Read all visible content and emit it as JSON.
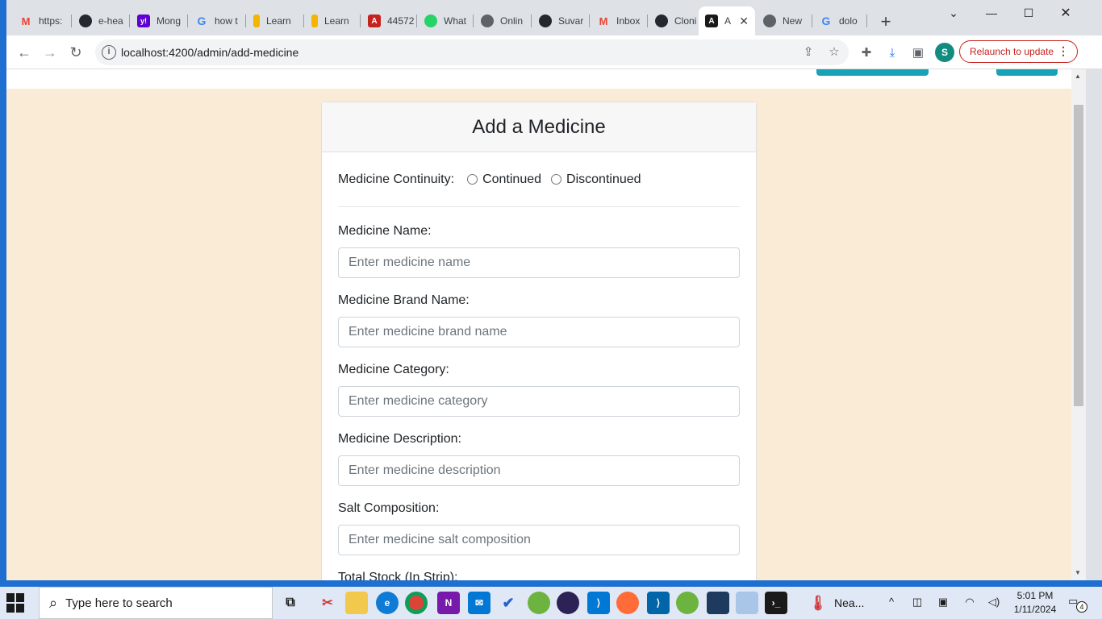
{
  "browser": {
    "tabs": [
      {
        "label": "https:",
        "icon": "gmail-icon",
        "color": "#ea4335",
        "glyph": "M"
      },
      {
        "label": "e-hea",
        "icon": "github-icon",
        "color": "#24292f",
        "glyph": "◉"
      },
      {
        "label": "Mong",
        "icon": "yahoo-icon",
        "color": "#6001d2",
        "glyph": "y!"
      },
      {
        "label": "how t",
        "icon": "google-icon",
        "color": "#4285f4",
        "glyph": "G"
      },
      {
        "label": "Learn",
        "icon": "learn-icon",
        "color": "#f4b400",
        "glyph": "|"
      },
      {
        "label": "Learn",
        "icon": "learn-icon",
        "color": "#f4b400",
        "glyph": "|"
      },
      {
        "label": "44572",
        "icon": "pdf-icon",
        "color": "#c5221f",
        "glyph": "A"
      },
      {
        "label": "What",
        "icon": "whatsapp-icon",
        "color": "#25d366",
        "glyph": "✆"
      },
      {
        "label": "Onlin",
        "icon": "globe-icon",
        "color": "#5f6368",
        "glyph": "◍"
      },
      {
        "label": "Suvar",
        "icon": "github-icon",
        "color": "#24292f",
        "glyph": "◉"
      },
      {
        "label": "Inbox",
        "icon": "gmail-icon",
        "color": "#ea4335",
        "glyph": "M"
      },
      {
        "label": "Clonii",
        "icon": "github-icon",
        "color": "#24292f",
        "glyph": "◉"
      },
      {
        "label": "A",
        "icon": "angular-icon",
        "color": "#1a1a1a",
        "glyph": "A",
        "active": true
      },
      {
        "label": "New",
        "icon": "globe-icon",
        "color": "#5f6368",
        "glyph": "◍"
      },
      {
        "label": "dolo",
        "icon": "google-icon",
        "color": "#4285f4",
        "glyph": "G"
      }
    ],
    "url": "localhost:4200/admin/add-medicine",
    "relaunch_label": "Relaunch to update",
    "profile_initial": "S"
  },
  "form": {
    "title": "Add a Medicine",
    "continuity_label": "Medicine Continuity:",
    "continuity_options": [
      "Continued",
      "Discontinued"
    ],
    "fields": [
      {
        "label": "Medicine Name:",
        "placeholder": "Enter medicine name"
      },
      {
        "label": "Medicine Brand Name:",
        "placeholder": "Enter medicine brand name"
      },
      {
        "label": "Medicine Category:",
        "placeholder": "Enter medicine category"
      },
      {
        "label": "Medicine Description:",
        "placeholder": "Enter medicine description"
      },
      {
        "label": "Salt Composition:",
        "placeholder": "Enter medicine salt composition"
      },
      {
        "label": "Total Stock (In Strip):",
        "placeholder": ""
      }
    ]
  },
  "taskbar": {
    "search_placeholder": "Type here to search",
    "weather_label": "Nea...",
    "time": "5:01 PM",
    "date": "1/11/2024",
    "notification_count": "4"
  }
}
